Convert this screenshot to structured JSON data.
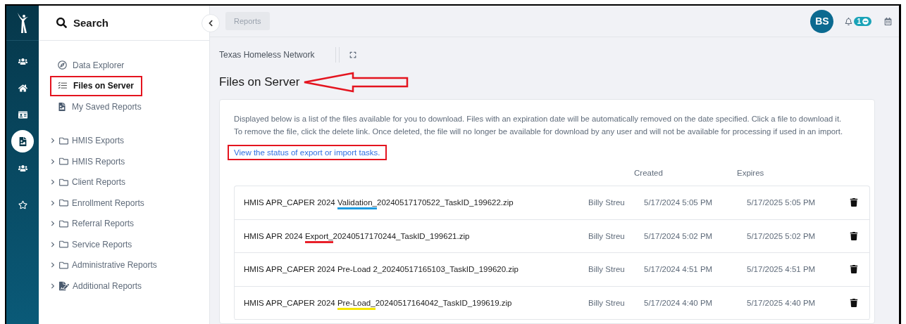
{
  "rail": [
    {
      "kind": "people",
      "selected": false
    },
    {
      "kind": "home",
      "selected": false
    },
    {
      "kind": "card",
      "selected": false
    },
    {
      "kind": "report",
      "selected": true
    },
    {
      "kind": "people",
      "selected": false
    },
    {
      "kind": "star",
      "selected": false
    }
  ],
  "sidebar": {
    "search_label": "Search",
    "links": [
      {
        "kind": "explorer",
        "label": "Data Explorer",
        "selected": false,
        "highlighted": false
      },
      {
        "kind": "checklist",
        "label": "Files on Server",
        "selected": true,
        "highlighted": true
      },
      {
        "kind": "saved",
        "label": "My Saved Reports",
        "selected": false,
        "highlighted": false
      }
    ],
    "folders": [
      {
        "kind": "folder",
        "label": "HMIS Exports",
        "expanded": false
      },
      {
        "kind": "folder",
        "label": "HMIS Reports",
        "expanded": false
      },
      {
        "kind": "folder",
        "label": "Client Reports",
        "expanded": false
      },
      {
        "kind": "folder",
        "label": "Enrollment Reports",
        "expanded": false
      },
      {
        "kind": "folder",
        "label": "Referral Reports",
        "expanded": false
      },
      {
        "kind": "folder",
        "label": "Service Reports",
        "expanded": false
      },
      {
        "kind": "folder",
        "label": "Administrative Reports",
        "expanded": false
      },
      {
        "kind": "signed",
        "label": "Additional Reports",
        "expanded": false
      }
    ]
  },
  "header": {
    "breadcrumb": "Reports",
    "avatar": "BS",
    "notification_count": "1"
  },
  "organization": "Texas Homeless Network",
  "page_heading": {
    "text": "Files on Server",
    "arrow": true
  },
  "description": [
    "Displayed below is a list of the files available for you to download. Files with an expiration date will be automatically removed on the date specified. Click a file to download it.",
    "To remove the file, click the delete link. Once deleted, the file will no longer be available for download by any user and will not be available for processing if used in an import."
  ],
  "status_link": {
    "text": "View the status of export or import tasks.",
    "highlighted": true
  },
  "table": {
    "columns": [
      "Created",
      "Expires"
    ],
    "rows": [
      {
        "file": [
          {
            "text": "HMIS APR_CAPER 2024 "
          },
          {
            "text": "Validation_",
            "color": "#1e9be0"
          },
          {
            "text": "20240517170522_TaskID_199622.zip"
          }
        ],
        "user": "Billy Streu",
        "created": "5/17/2024 5:05 PM",
        "expires": "5/17/2025 5:05 PM"
      },
      {
        "file": [
          {
            "text": "HMIS APR 2024 "
          },
          {
            "text": "Export_",
            "color": "#e8202a"
          },
          {
            "text": "20240517170244_TaskID_199621.zip"
          }
        ],
        "user": "Billy Streu",
        "created": "5/17/2024 5:02 PM",
        "expires": "5/17/2025 5:02 PM"
      },
      {
        "file": [
          {
            "text": "HMIS APR_CAPER 2024 Pre-Load 2_20240517165103_TaskID_199620.zip"
          }
        ],
        "user": "Billy Streu",
        "created": "5/17/2024 4:51 PM",
        "expires": "5/17/2025 4:51 PM"
      },
      {
        "file": [
          {
            "text": "HMIS APR_CAPER 2024 "
          },
          {
            "text": "Pre-Load_",
            "color": "#f5e600"
          },
          {
            "text": "20240517164042_TaskID_199619.zip"
          }
        ],
        "user": "Billy Streu",
        "created": "5/17/2024 4:40 PM",
        "expires": "5/17/2025 4:40 PM"
      }
    ]
  }
}
